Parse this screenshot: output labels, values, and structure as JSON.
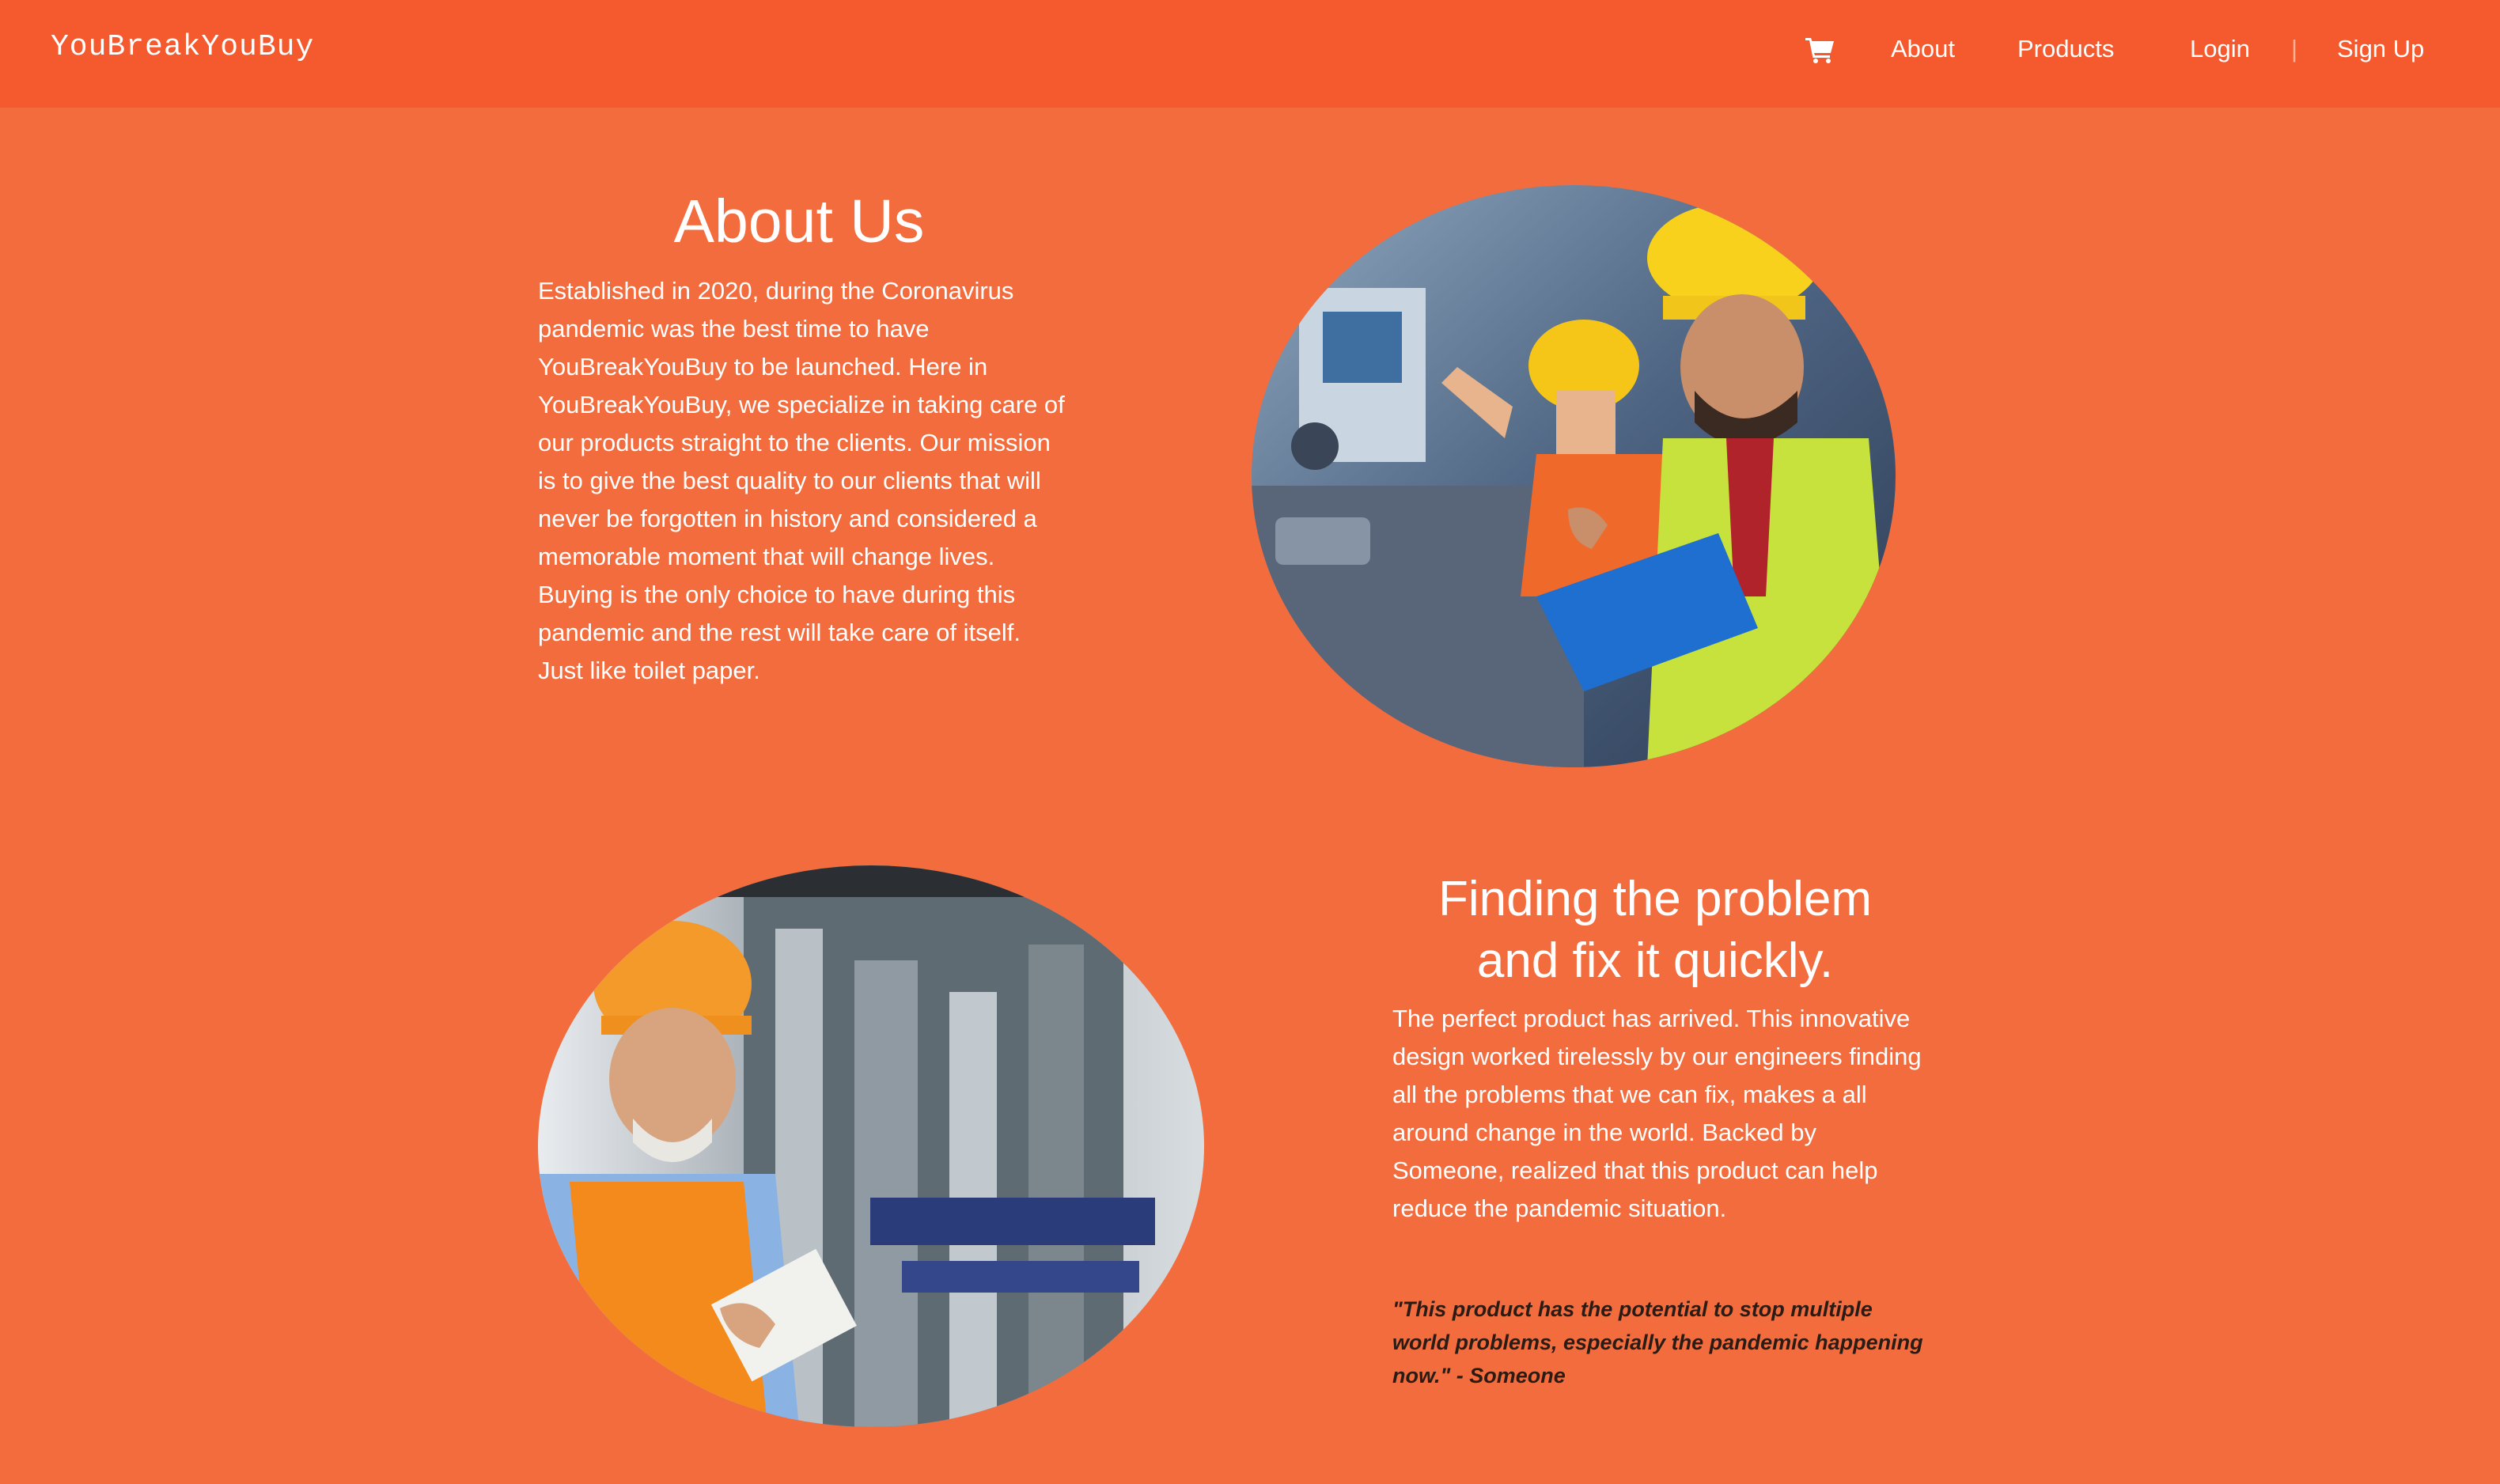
{
  "navbar": {
    "brand": "YouBreakYouBuy",
    "cart_icon": "shopping-cart-icon",
    "links": {
      "about": "About",
      "products": "Products",
      "login": "Login",
      "separator": "|",
      "signup": "Sign Up"
    }
  },
  "about": {
    "title": "About Us",
    "text": "Established in 2020, during the Coronavirus pandemic was the best time to have YouBreakYouBuy to be launched. Here in YouBreakYouBuy, we specialize in taking care of our products straight to the clients. Our mission is to give the best quality to our clients that will never be forgotten in history and considered a memorable moment that will change lives. Buying is the only choice to have during this pandemic and the rest will take care of itself. Just like toilet paper."
  },
  "problem": {
    "title_line1": "Finding the problem",
    "title_line2": "and fix it quickly.",
    "text": "The perfect product has arrived. This innovative design worked tirelessly by our engineers finding all the problems that we can fix, makes a all around change in the world. Backed by Someone, realized that this product can help reduce the pandemic situation.",
    "quote": "\"This product has the potential to stop multiple world problems, especially the pandemic happening now.\" - Someone"
  },
  "colors": {
    "page_background": "#F36C3D",
    "navbar_background": "#F55A2E",
    "text": "#FFFFFF",
    "quote_text": "#2A1B14"
  }
}
